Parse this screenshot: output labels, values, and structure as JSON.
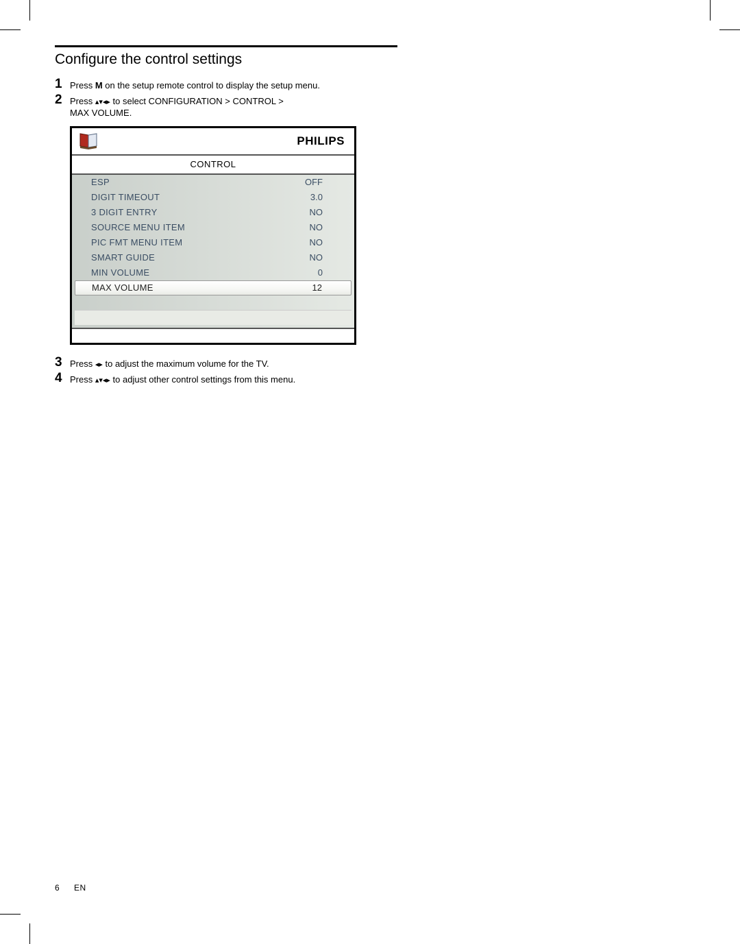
{
  "section_title": "Configure the control settings",
  "steps": {
    "s1": {
      "num": "1",
      "text_a": "Press ",
      "key": "M",
      "text_b": " on the setup remote control to display the setup menu."
    },
    "s2": {
      "num": "2",
      "text_a": "Press ",
      "arrows": "▴▾◂▸",
      "text_b": " to select ",
      "path1": "CONFIGURATION",
      "gt1": " > ",
      "path2": "CONTROL",
      "gt2": " > ",
      "path3": "MAX VOLUME",
      "dot": "."
    },
    "s3": {
      "num": "3",
      "text_a": "Press ",
      "arrows": "◂▸",
      "text_b": " to adjust the maximum volume for the TV."
    },
    "s4": {
      "num": "4",
      "text_a": "Press ",
      "arrows": "▴▾◂▸",
      "text_b": " to adjust other control settings from this menu."
    }
  },
  "osd": {
    "brand": "PHILIPS",
    "tab": "CONTROL",
    "rows": [
      {
        "label": "ESP",
        "value": "OFF"
      },
      {
        "label": "DIGIT TIMEOUT",
        "value": "3.0"
      },
      {
        "label": "3 DIGIT ENTRY",
        "value": "NO"
      },
      {
        "label": "SOURCE MENU ITEM",
        "value": "NO"
      },
      {
        "label": "PIC FMT MENU ITEM",
        "value": "NO"
      },
      {
        "label": "SMART GUIDE",
        "value": "NO"
      },
      {
        "label": "MIN VOLUME",
        "value": "0"
      },
      {
        "label": "MAX VOLUME",
        "value": "12"
      }
    ],
    "selected_index": 7
  },
  "footer": {
    "page": "6",
    "lang": "EN"
  }
}
